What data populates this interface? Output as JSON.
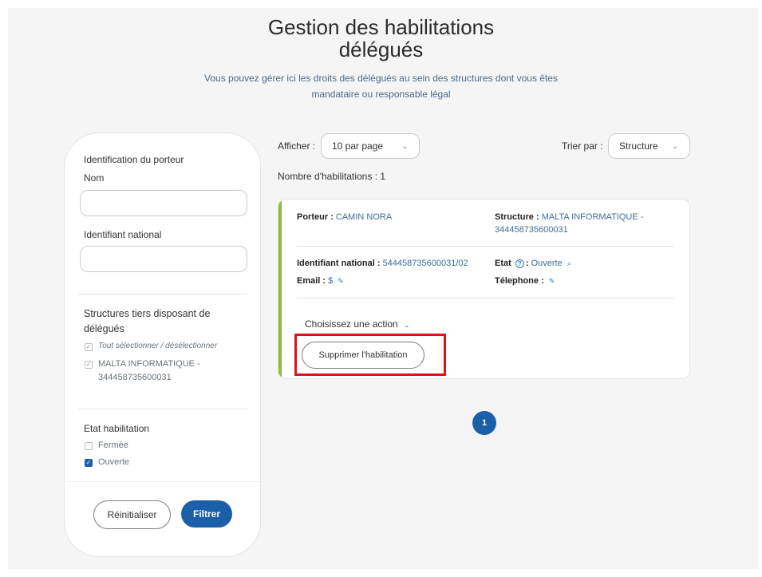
{
  "page": {
    "title_line1": "Gestion des habilitations",
    "title_line2": "délégués",
    "subtitle_line1": "Vous pouvez gérer ici les droits des délégués au sein des structures dont vous êtes",
    "subtitle_line2": "mandataire ou responsable légal"
  },
  "sidebar": {
    "section_identification": "Identification du porteur",
    "nom_label": "Nom",
    "nom_value": "",
    "identifiant_label": "Identifiant national",
    "identifiant_value": "",
    "structures_title_line1": "Structures tiers disposant de",
    "structures_title_line2": "délégués",
    "select_all_label": "Tout sélectionner / désélectionner",
    "structure_item_line1": "MALTA INFORMATIQUE -",
    "structure_item_line2": "344458735600031",
    "etat_title": "Etat habilitation",
    "etat_options": [
      {
        "label": "Fermée",
        "checked": false
      },
      {
        "label": "Ouverte",
        "checked": true
      }
    ],
    "reset_label": "Réinitialiser",
    "filter_label": "Filtrer"
  },
  "controls": {
    "afficher_label": "Afficher :",
    "afficher_value": "10 par page",
    "trier_label": "Trier par :",
    "trier_value": "Structure",
    "count_text": "Nombre d'habilitations : 1"
  },
  "card": {
    "porteur_label": "Porteur :",
    "porteur_value": "CAMIN NORA",
    "structure_label": "Structure :",
    "structure_value_line1": "MALTA INFORMATIQUE -",
    "structure_value_line2": "344458735600031",
    "identifiant_label": "Identifiant national :",
    "identifiant_value": "544458735600031/02",
    "etat_label": "Etat",
    "etat_value": "Ouverte",
    "email_label": "Email :",
    "email_value": "$",
    "telephone_label": "Télephone :",
    "action_label": "Choisissez une action",
    "delete_label": "Supprimer l'habilitation"
  },
  "pagination": {
    "current_page": "1"
  },
  "colors": {
    "primary": "#1a5fa8",
    "accent_bar": "#8bbd3c",
    "highlight": "#e0101a"
  }
}
